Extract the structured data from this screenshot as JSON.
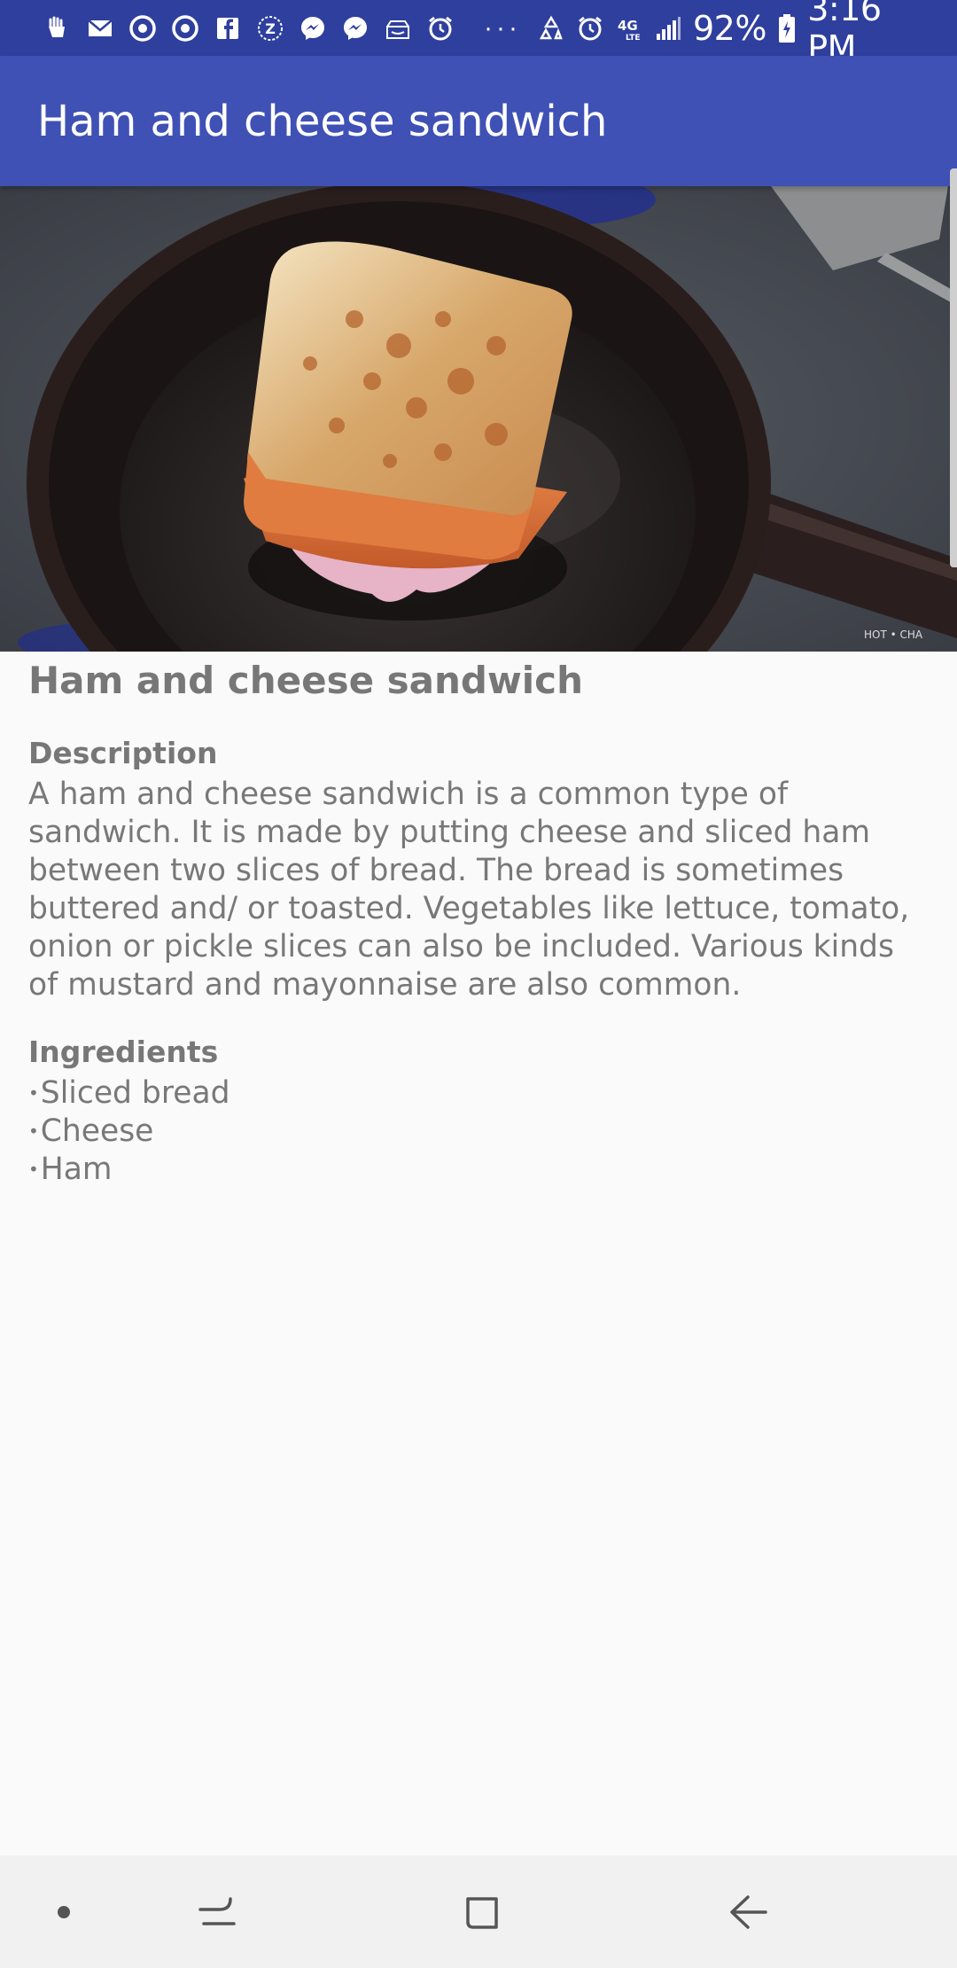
{
  "status_bar": {
    "left_icons": [
      "hand-icon",
      "mail-icon",
      "target-icon",
      "target-icon",
      "facebook-icon",
      "z-badge-icon",
      "messenger-icon",
      "messenger-icon",
      "amazon-icon",
      "alarm-icon"
    ],
    "more_indicator": "···",
    "right_icons": [
      "recycle-icon",
      "alarm-icon",
      "4g-lte-icon",
      "signal-icon"
    ],
    "battery_percent": "92%",
    "time": "3:16 PM"
  },
  "app_bar": {
    "title": "Ham and cheese sandwich"
  },
  "recipe": {
    "title": "Ham and cheese sandwich",
    "description_heading": "Description",
    "description": "A ham and cheese sandwich is a common type of sandwich. It is made by putting cheese and sliced ham between two slices of bread. The bread is sometimes buttered and/ or toasted. Vegetables like lettuce, tomato, onion or pickle slices can also be included. Various kinds of mustard and mayonnaise are also common.",
    "ingredients_heading": "Ingredients",
    "ingredients": [
      "Sliced bread",
      "Cheese",
      "Ham"
    ],
    "bullet": "•"
  },
  "nav_bar": {
    "icons": [
      "dot-icon",
      "recent-apps-icon",
      "home-icon",
      "back-icon"
    ]
  },
  "colors": {
    "status_bar": "#2f3f9e",
    "app_bar": "#3f51b5",
    "text": "#777777",
    "background": "#fafafa",
    "nav_bar": "#f1f1f1"
  }
}
